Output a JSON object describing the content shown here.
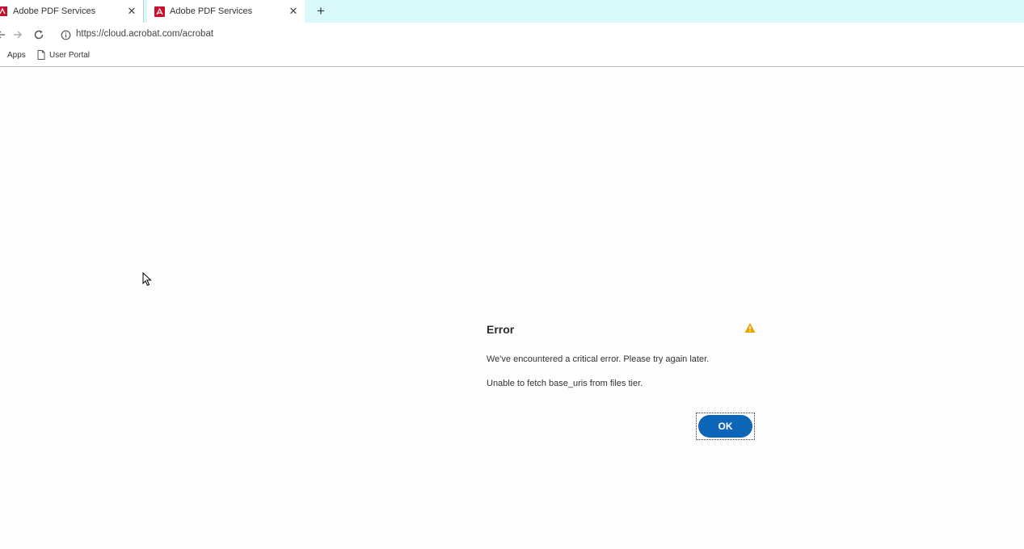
{
  "tabs": [
    {
      "title": "Adobe PDF Services",
      "icon": "adobe-pdf-icon"
    },
    {
      "title": "Adobe PDF Services",
      "icon": "adobe-pdf-icon"
    }
  ],
  "tab_close_glyph": "✕",
  "new_tab_glyph": "+",
  "toolbar": {
    "url_host": "https://cloud.acrobat.com",
    "url_path": "/acrobat"
  },
  "bookmarks": [
    {
      "label": "Apps",
      "icon": "apps-icon"
    },
    {
      "label": "User Portal",
      "icon": "page-icon"
    }
  ],
  "dialog": {
    "title": "Error",
    "message": "We've encountered a critical error. Please try again later.",
    "detail": "Unable to fetch base_uris from files tier.",
    "ok_label": "OK",
    "warning_color": "#e8a400"
  },
  "colors": {
    "tabstrip": "#d8f8fb",
    "adobe_red": "#c8102e",
    "ok_button": "#0d66b8"
  }
}
